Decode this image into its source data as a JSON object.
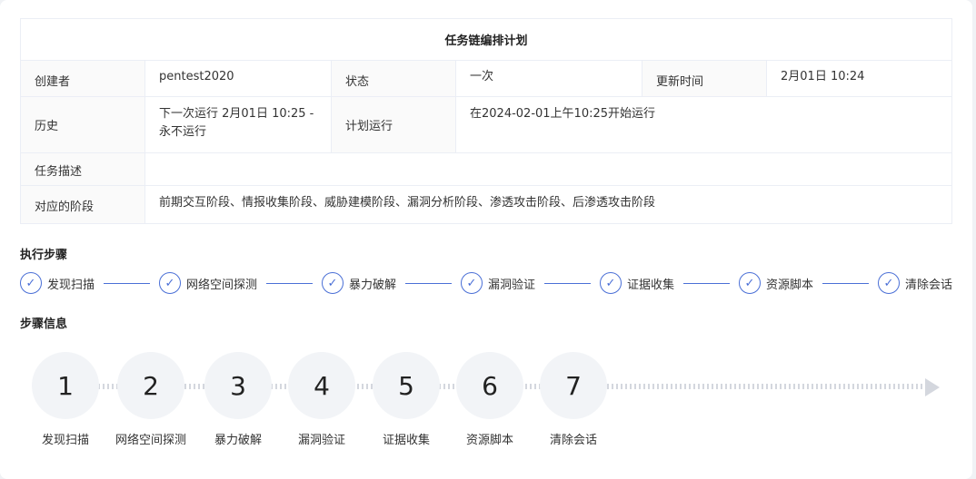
{
  "table": {
    "title": "任务链编排计划",
    "row1": {
      "creator_label": "创建者",
      "creator_value": "pentest2020",
      "status_label": "状态",
      "status_value": "一次",
      "updated_label": "更新时间",
      "updated_value": "2月01日 10:24"
    },
    "row2": {
      "history_label": "历史",
      "history_value_line1": "下一次运行 2月01日 10:25 -",
      "history_value_line2": "永不运行",
      "plan_label": "计划运行",
      "plan_value": "在2024-02-01上午10:25开始运行"
    },
    "row3": {
      "desc_label": "任务描述",
      "desc_value": ""
    },
    "row4": {
      "stage_label": "对应的阶段",
      "stage_value": "前期交互阶段、情报收集阶段、威胁建模阶段、漏洞分析阶段、渗透攻击阶段、后渗透攻击阶段"
    }
  },
  "exec_steps": {
    "title": "执行步骤",
    "check_glyph": "✓",
    "items": [
      "发现扫描",
      "网络空间探测",
      "暴力破解",
      "漏洞验证",
      "证据收集",
      "资源脚本",
      "清除会话"
    ]
  },
  "step_info": {
    "title": "步骤信息",
    "nodes": [
      {
        "num": "1",
        "label": "发现扫描"
      },
      {
        "num": "2",
        "label": "网络空间探测"
      },
      {
        "num": "3",
        "label": "暴力破解"
      },
      {
        "num": "4",
        "label": "漏洞验证"
      },
      {
        "num": "5",
        "label": "证据收集"
      },
      {
        "num": "6",
        "label": "资源脚本"
      },
      {
        "num": "7",
        "label": "清除会话"
      }
    ]
  },
  "colors": {
    "accent": "#4a6fd6",
    "node_bg": "#f2f4f7",
    "dots": "#d4d7de"
  }
}
